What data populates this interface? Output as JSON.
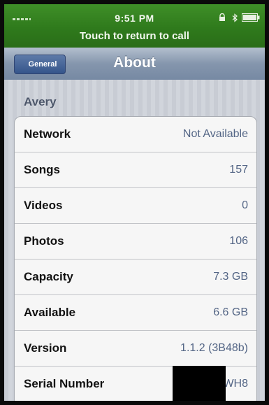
{
  "status_bar": {
    "time": "9:51 PM",
    "call_banner": "Touch to return to call"
  },
  "nav": {
    "back_label": "General",
    "title": "About"
  },
  "device_name": "Avery",
  "rows": [
    {
      "label": "Network",
      "value": "Not Available"
    },
    {
      "label": "Songs",
      "value": "157"
    },
    {
      "label": "Videos",
      "value": "0"
    },
    {
      "label": "Photos",
      "value": "106"
    },
    {
      "label": "Capacity",
      "value": "7.3 GB"
    },
    {
      "label": "Available",
      "value": "6.6 GB"
    },
    {
      "label": "Version",
      "value": "1.1.2 (3B48b)"
    },
    {
      "label": "Serial Number",
      "value": "82        WH8"
    }
  ],
  "colors": {
    "status_bar_green": "#2f7a1c",
    "nav_blue_gray": "#8596ad",
    "value_text": "#536585"
  }
}
